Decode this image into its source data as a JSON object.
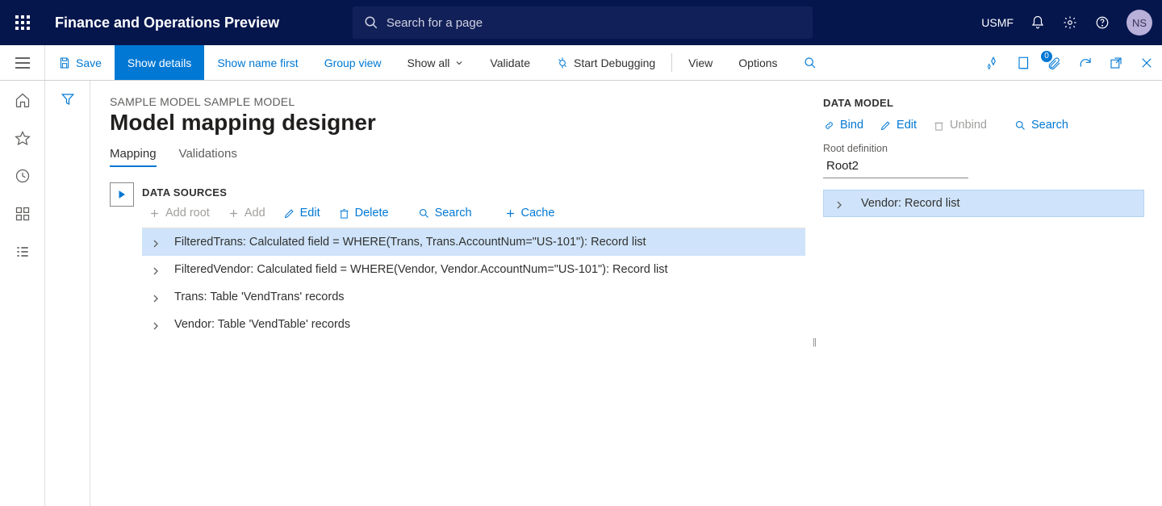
{
  "topbar": {
    "app_title": "Finance and Operations Preview",
    "search_placeholder": "Search for a page",
    "legal_entity": "USMF",
    "avatar_initials": "NS"
  },
  "actionbar": {
    "save": "Save",
    "show_details": "Show details",
    "show_name_first": "Show name first",
    "group_view": "Group view",
    "show_all": "Show all",
    "validate": "Validate",
    "start_debugging": "Start Debugging",
    "view": "View",
    "options": "Options",
    "attachments_count": "0"
  },
  "page": {
    "breadcrumb": "SAMPLE MODEL SAMPLE MODEL",
    "title": "Model mapping designer",
    "tabs": {
      "mapping": "Mapping",
      "validations": "Validations"
    }
  },
  "datasources": {
    "heading": "DATA SOURCES",
    "toolbar": {
      "add_root": "Add root",
      "add": "Add",
      "edit": "Edit",
      "delete": "Delete",
      "search": "Search",
      "cache": "Cache"
    },
    "rows": [
      "FilteredTrans: Calculated field = WHERE(Trans, Trans.AccountNum=\"US-101\"): Record list",
      "FilteredVendor: Calculated field = WHERE(Vendor, Vendor.AccountNum=\"US-101\"): Record list",
      "Trans: Table 'VendTrans' records",
      "Vendor: Table 'VendTable' records"
    ]
  },
  "datamodel": {
    "heading": "DATA MODEL",
    "toolbar": {
      "bind": "Bind",
      "edit": "Edit",
      "unbind": "Unbind",
      "search": "Search"
    },
    "root_definition_label": "Root definition",
    "root_definition_value": "Root2",
    "rows": [
      "Vendor: Record list"
    ]
  }
}
